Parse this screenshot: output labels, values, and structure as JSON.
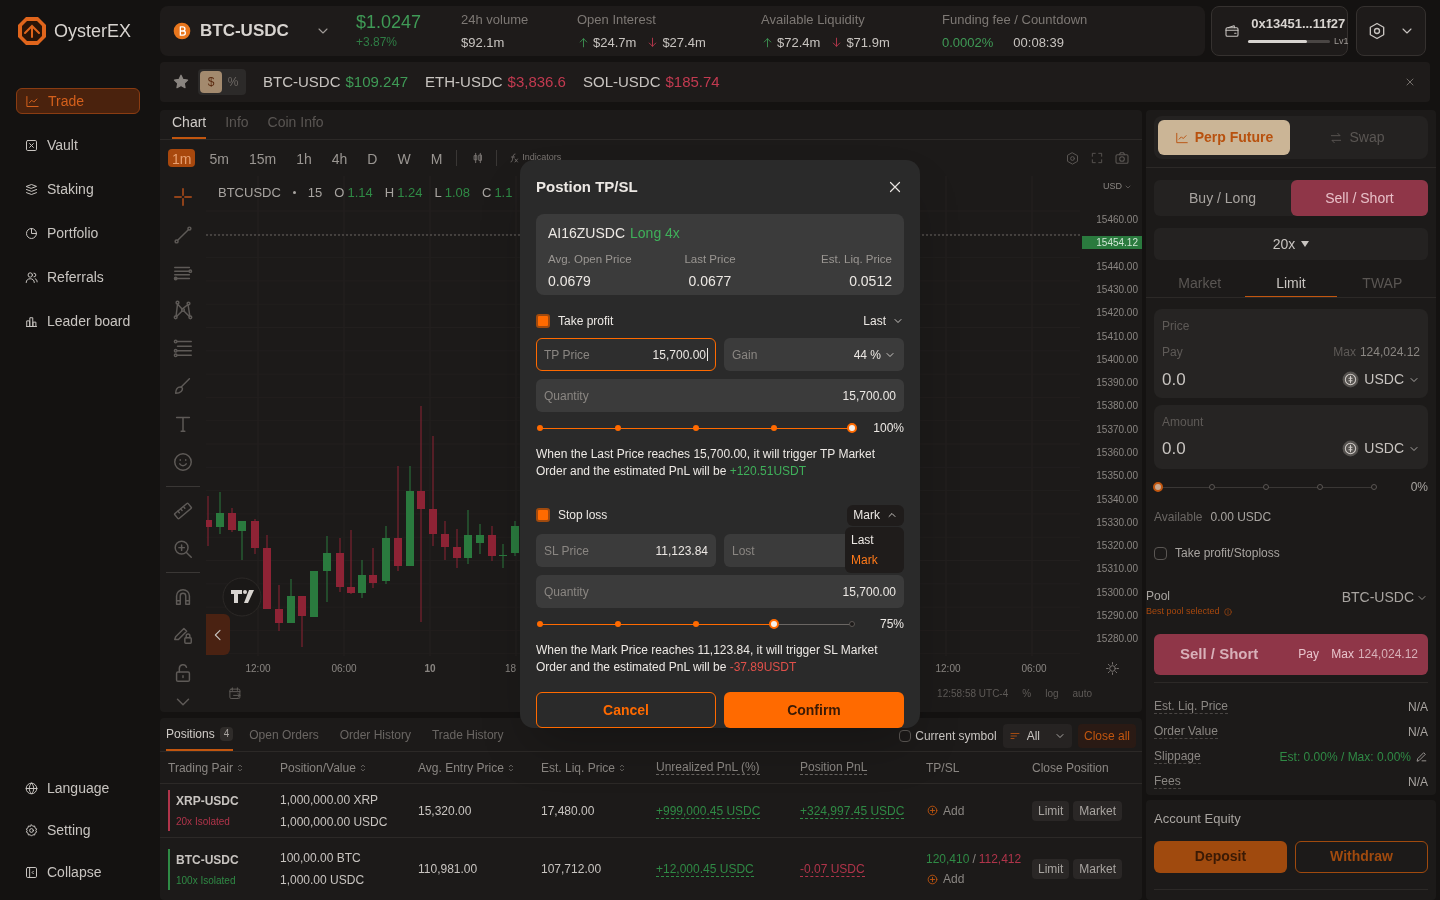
{
  "brand": {
    "name": "OysterEX"
  },
  "nav": [
    {
      "label": "Trade",
      "selected": true
    },
    {
      "label": "Vault",
      "selected": false
    },
    {
      "label": "Staking",
      "selected": false
    },
    {
      "label": "Portfolio",
      "selected": false
    },
    {
      "label": "Referrals",
      "selected": false
    },
    {
      "label": "Leader board",
      "selected": false
    }
  ],
  "sidebar_footer": [
    "Language",
    "Setting",
    "Collapse"
  ],
  "market": {
    "pair": "BTC-USDC",
    "price": "$1.0247",
    "change": "+3.87%",
    "stats": [
      {
        "label": "24h volume",
        "values": [
          {
            "text": "$92.1m",
            "kind": "plain"
          }
        ]
      },
      {
        "label": "Open Interest",
        "values": [
          {
            "text": "$24.7m",
            "kind": "up"
          },
          {
            "text": "$27.4m",
            "kind": "down"
          }
        ]
      },
      {
        "label": "Available Liquidity",
        "values": [
          {
            "text": "$72.4m",
            "kind": "up"
          },
          {
            "text": "$71.9m",
            "kind": "down"
          }
        ]
      },
      {
        "label": "Funding fee / Countdown",
        "values": [
          {
            "text": "0.0002%",
            "kind": "positive"
          },
          {
            "text": "00:08:39",
            "kind": "plain"
          }
        ]
      }
    ]
  },
  "wallet": {
    "address": "0x13451...11f27",
    "rank": "Lv1",
    "progress": {
      "level": 0.72
    }
  },
  "watchlist": {
    "modes": [
      {
        "label": "$",
        "selected": true
      },
      {
        "label": "%",
        "selected": false
      }
    ],
    "tickers": [
      {
        "symbol": "BTC-USDC",
        "price": "$109.247",
        "color": "#3f9a56"
      },
      {
        "symbol": "ETH-USDC",
        "price": "$3,836.6",
        "color": "#c23a50"
      },
      {
        "symbol": "SOL-USDC",
        "price": "$185.74",
        "color": "#c23a50"
      }
    ]
  },
  "chart": {
    "tabs": [
      {
        "label": "Chart",
        "selected": true
      },
      {
        "label": "Info",
        "selected": false
      },
      {
        "label": "Coin Info",
        "selected": false
      }
    ],
    "timeframes": [
      {
        "label": "1m",
        "selected": true
      },
      {
        "label": "5m",
        "selected": false
      },
      {
        "label": "15m",
        "selected": false
      },
      {
        "label": "1h",
        "selected": false
      },
      {
        "label": "4h",
        "selected": false
      },
      {
        "label": "D",
        "selected": false
      },
      {
        "label": "W",
        "selected": false
      },
      {
        "label": "M",
        "selected": false
      }
    ],
    "indicators": "Indicators",
    "legend": {
      "symbol": "BTCUSDC",
      "interval": "15",
      "values": [
        {
          "key": "O",
          "value": "1.14"
        },
        {
          "key": "H",
          "value": "1.24"
        },
        {
          "key": "L",
          "value": "1.08"
        },
        {
          "key": "C",
          "value": "1.1"
        }
      ]
    },
    "price_axis": {
      "currency": "USD",
      "labels": [
        {
          "text": "15460.00",
          "kind": "tick"
        },
        {
          "text": "15454.12",
          "kind": "last-price"
        },
        {
          "text": "15440.00",
          "kind": "tick"
        },
        {
          "text": "15430.00",
          "kind": "tick"
        },
        {
          "text": "15420.00",
          "kind": "tick"
        },
        {
          "text": "15410.00",
          "kind": "tick"
        },
        {
          "text": "15400.00",
          "kind": "tick"
        },
        {
          "text": "15390.00",
          "kind": "tick"
        },
        {
          "text": "15380.00",
          "kind": "tick"
        },
        {
          "text": "15370.00",
          "kind": "tick"
        },
        {
          "text": "15360.00",
          "kind": "tick"
        },
        {
          "text": "15350.00",
          "kind": "tick"
        },
        {
          "text": "15340.00",
          "kind": "tick"
        },
        {
          "text": "15330.00",
          "kind": "tick"
        },
        {
          "text": "15320.00",
          "kind": "tick"
        },
        {
          "text": "15310.00",
          "kind": "tick"
        },
        {
          "text": "15300.00",
          "kind": "tick"
        },
        {
          "text": "15290.00",
          "kind": "tick"
        },
        {
          "text": "15280.00",
          "kind": "tick"
        }
      ]
    },
    "time_axis_left": [
      {
        "text": "12:00",
        "kind": "time"
      },
      {
        "text": "06:00",
        "kind": "time"
      },
      {
        "text": "10",
        "kind": "day"
      },
      {
        "text": "18",
        "kind": "partial"
      }
    ],
    "time_axis_right": [
      {
        "text": "12:00",
        "kind": "time"
      },
      {
        "text": "06:00",
        "kind": "time"
      }
    ],
    "clock": "12:58:58 UTC-4",
    "scale_options": [
      "%",
      "log",
      "auto"
    ]
  },
  "positions": {
    "tabs": [
      {
        "label": "Positions",
        "count": "4",
        "selected": true
      },
      {
        "label": "Open Orders",
        "selected": false
      },
      {
        "label": "Order History",
        "selected": false
      },
      {
        "label": "Trade History",
        "selected": false
      }
    ],
    "current_symbol": {
      "label": "Current symbol",
      "checked": false
    },
    "filter": "All",
    "close_all": "Close all",
    "columns": [
      {
        "label": "Trading Pair",
        "sortable": true,
        "dotted": false
      },
      {
        "label": "Position/Value",
        "sortable": true,
        "dotted": false
      },
      {
        "label": "Avg. Entry Price",
        "sortable": true,
        "dotted": false
      },
      {
        "label": "Est. Liq. Price",
        "sortable": true,
        "dotted": false
      },
      {
        "label": "Unrealized PnL (%)",
        "sortable": false,
        "dotted": true
      },
      {
        "label": "Position PnL",
        "sortable": false,
        "dotted": true
      },
      {
        "label": "TP/SL",
        "sortable": false,
        "dotted": false
      },
      {
        "label": "Close Position",
        "sortable": false,
        "dotted": false
      }
    ],
    "rows": [
      {
        "pair": "XRP-USDC",
        "margin": "20x Isolated",
        "color": "#b0344a",
        "position": "1,000,000.00 XRP",
        "value": "1,000,000.00 USDC",
        "entry": "15,320.00",
        "liq": "17,480.00",
        "unrealized": {
          "text": "+999,000.45 USDC",
          "color": "#2f8a45"
        },
        "pnl": {
          "text": "+324,997.45 USDC",
          "color": "#2f8a45"
        },
        "tpsl": {
          "add": "Add"
        },
        "actions": [
          "Limit",
          "Market"
        ]
      },
      {
        "pair": "BTC-USDC",
        "margin": "100x Isolated",
        "color": "#2f8a45",
        "position": "100,00.00 BTC",
        "value": "1,000.00 USDC",
        "entry": "110,981.00",
        "liq": "107,712.00",
        "unrealized": {
          "text": "+12,000.45 USDC",
          "color": "#2f8a45"
        },
        "pnl": {
          "text": "-0.07 USDC",
          "color": "#b0344a"
        },
        "tpsl": {
          "tp": "120,410",
          "separator": "/",
          "sl": "112,412",
          "add": "Add"
        },
        "actions": [
          "Limit",
          "Market"
        ]
      }
    ]
  },
  "trade": {
    "modes": [
      {
        "label": "Perp Future",
        "selected": true
      },
      {
        "label": "Swap",
        "selected": false
      }
    ],
    "sides": [
      {
        "label": "Buy / Long",
        "selected": false
      },
      {
        "label": "Sell / Short",
        "selected": true
      }
    ],
    "leverage": "20x",
    "order_types": [
      {
        "label": "Market",
        "selected": false
      },
      {
        "label": "Limit",
        "selected": true
      },
      {
        "label": "TWAP",
        "selected": false
      }
    ],
    "price": {
      "label": "Price",
      "sub_label": "Pay",
      "max_label": "Max",
      "max": "124,024.12",
      "value": "0.0",
      "token": "USDC"
    },
    "amount": {
      "label": "Amount",
      "value": "0.0",
      "token": "USDC"
    },
    "slider": {
      "level": 0,
      "reading": "0%"
    },
    "available": {
      "label": "Available",
      "value": "0.00",
      "token": "USDC"
    },
    "tpsl": {
      "label": "Take profit/Stoploss",
      "checked": false
    },
    "pool": {
      "label": "Pool",
      "hint": "Best pool selected",
      "value": "BTC-USDC"
    },
    "submit": {
      "label": "Sell / Short",
      "pay": "Pay",
      "max_label": "Max",
      "max": "124,024.12"
    },
    "summary": [
      {
        "label": "Est. Liq. Price",
        "value": "N/A",
        "color": "#a8a4a0",
        "editable": false
      },
      {
        "label": "Order Value",
        "value": "N/A",
        "color": "#a8a4a0",
        "editable": false
      },
      {
        "label": "Slippage",
        "value": "Est: 0.00% / Max: 0.00%",
        "color": "#2f8a45",
        "editable": true
      },
      {
        "label": "Fees",
        "value": "N/A",
        "color": "#a8a4a0",
        "editable": false
      }
    ]
  },
  "account": {
    "title": "Account Equity",
    "deposit": "Deposit",
    "withdraw": "Withdraw"
  },
  "modal": {
    "title": "Postion TP/SL",
    "position": {
      "symbol": "AI16ZUSDC",
      "side": "Long 4x",
      "stats": [
        {
          "label": "Avg. Open Price",
          "value": "0.0679"
        },
        {
          "label": "Last Price",
          "value": "0.0677"
        },
        {
          "label": "Est. Liq. Price",
          "value": "0.0512"
        }
      ]
    },
    "sections": [
      {
        "label": "Take profit",
        "checked": true,
        "trigger": "Last",
        "menu_open": false,
        "price": {
          "label": "TP Price",
          "value": "15,700.00",
          "focused": true
        },
        "change": {
          "label": "Gain",
          "value": "44 %"
        },
        "quantity": {
          "label": "Quantity",
          "value": "15,700.00"
        },
        "slider": {
          "level": 1,
          "reading": "100%"
        },
        "note": "When the Last Price reaches 15,700.00, it will trigger TP Market Order and the estimated PnL will be ",
        "pnl": {
          "text": "+120.51USDT",
          "color": "#3fb05a"
        }
      },
      {
        "label": "Stop loss",
        "checked": true,
        "trigger": "Mark",
        "menu_open": true,
        "menu": [
          {
            "label": "Last",
            "selected": false
          },
          {
            "label": "Mark",
            "selected": true
          }
        ],
        "price": {
          "label": "SL Price",
          "value": "11,123.84",
          "focused": false
        },
        "change": {
          "label": "Lost"
        },
        "quantity": {
          "label": "Quantity",
          "value": "15,700.00"
        },
        "slider": {
          "level": 0.75,
          "reading": "75%"
        },
        "note": "When the Mark Price reaches 11,123.84, it will trigger SL Market Order and the estimated PnL will be ",
        "pnl": {
          "text": "-37.89USDT",
          "color": "#e0504a"
        }
      }
    ],
    "cancel": "Cancel",
    "confirm": "Confirm"
  }
}
